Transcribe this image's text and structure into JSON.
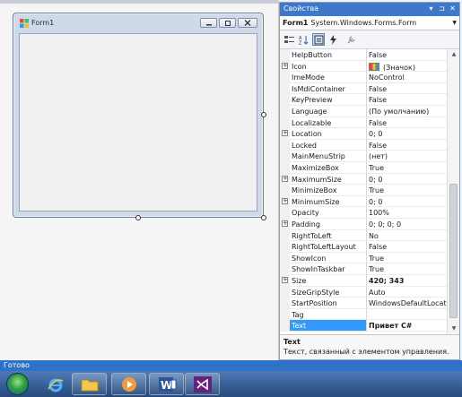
{
  "form": {
    "title": "Form1"
  },
  "properties_panel": {
    "title": "Свойства",
    "object_name": "Form1",
    "object_type": "System.Windows.Forms.Form",
    "rows": [
      {
        "name": "HelpButton",
        "value": "False",
        "expandable": false
      },
      {
        "name": "Icon",
        "value": "(Значок)",
        "expandable": true,
        "has_icon": true
      },
      {
        "name": "ImeMode",
        "value": "NoControl",
        "expandable": false
      },
      {
        "name": "IsMdiContainer",
        "value": "False",
        "expandable": false
      },
      {
        "name": "KeyPreview",
        "value": "False",
        "expandable": false
      },
      {
        "name": "Language",
        "value": "(По умолчанию)",
        "expandable": false
      },
      {
        "name": "Localizable",
        "value": "False",
        "expandable": false
      },
      {
        "name": "Location",
        "value": "0; 0",
        "expandable": true
      },
      {
        "name": "Locked",
        "value": "False",
        "expandable": false
      },
      {
        "name": "MainMenuStrip",
        "value": "(нет)",
        "expandable": false
      },
      {
        "name": "MaximizeBox",
        "value": "True",
        "expandable": false
      },
      {
        "name": "MaximumSize",
        "value": "0; 0",
        "expandable": true
      },
      {
        "name": "MinimizeBox",
        "value": "True",
        "expandable": false
      },
      {
        "name": "MinimumSize",
        "value": "0; 0",
        "expandable": true
      },
      {
        "name": "Opacity",
        "value": "100%",
        "expandable": false
      },
      {
        "name": "Padding",
        "value": "0; 0; 0; 0",
        "expandable": true
      },
      {
        "name": "RightToLeft",
        "value": "No",
        "expandable": false
      },
      {
        "name": "RightToLeftLayout",
        "value": "False",
        "expandable": false
      },
      {
        "name": "ShowIcon",
        "value": "True",
        "expandable": false
      },
      {
        "name": "ShowInTaskbar",
        "value": "True",
        "expandable": false
      },
      {
        "name": "Size",
        "value": "420; 343",
        "expandable": true,
        "bold": true
      },
      {
        "name": "SizeGripStyle",
        "value": "Auto",
        "expandable": false
      },
      {
        "name": "StartPosition",
        "value": "WindowsDefaultLocation",
        "expandable": false
      },
      {
        "name": "Tag",
        "value": "",
        "expandable": false
      },
      {
        "name": "Text",
        "value": "Привет C#",
        "expandable": false,
        "bold": true,
        "selected": true
      }
    ],
    "description": {
      "title": "Text",
      "text": "Текст, связанный с элементом управления."
    }
  },
  "statusbar": {
    "text": "Готово"
  },
  "taskbar": {
    "apps": [
      "internet-explorer",
      "windows-explorer",
      "media-player",
      "word",
      "visual-studio"
    ]
  },
  "colors": {
    "accent": "#3e78c9",
    "selection": "#3399ff",
    "statusbar": "#2f71c6"
  }
}
